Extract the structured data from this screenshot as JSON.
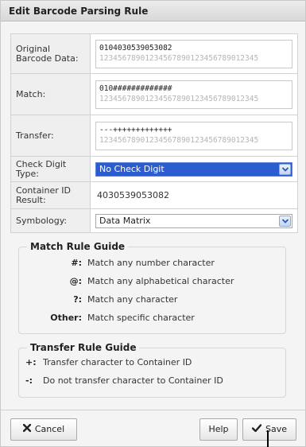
{
  "dialog": {
    "title": "Edit Barcode Parsing Rule"
  },
  "form": {
    "original": {
      "label": "Original Barcode Data:",
      "value": "0104030539053082",
      "ruler": "12345678901234567890123456789012345"
    },
    "match": {
      "label": "Match:",
      "value": "010#############",
      "ruler": "12345678901234567890123456789012345"
    },
    "transfer": {
      "label": "Transfer:",
      "value": "---+++++++++++++",
      "ruler": "12345678901234567890123456789012345"
    },
    "check_digit": {
      "label": "Check Digit Type:",
      "selected": "No Check Digit"
    },
    "container_id": {
      "label": "Container ID Result:",
      "value": "4030539053082"
    },
    "symbology": {
      "label": "Symbology:",
      "selected": "Data Matrix"
    }
  },
  "match_guide": {
    "title": "Match Rule Guide",
    "rows": [
      {
        "sym": "#:",
        "desc": "Match any number character"
      },
      {
        "sym": "@:",
        "desc": "Match any alphabetical character"
      },
      {
        "sym": "?:",
        "desc": "Match any character"
      },
      {
        "sym": "Other:",
        "desc": "Match specific character"
      }
    ]
  },
  "transfer_guide": {
    "title": "Transfer Rule Guide",
    "rows": [
      {
        "sym": "+:",
        "desc": "Transfer character to Container ID"
      },
      {
        "sym": "-:",
        "desc": "Do not transfer character to Container ID"
      }
    ]
  },
  "footer": {
    "cancel_label": "Cancel",
    "help_label": "Help",
    "save_label": "Save"
  },
  "icons": {
    "cancel": "close-x-icon",
    "save": "checkmark-icon",
    "dropdown": "chevron-down-icon"
  },
  "colors": {
    "focus_select": "#2b5cd0",
    "dropdown_arrow": "#2a55b0"
  }
}
